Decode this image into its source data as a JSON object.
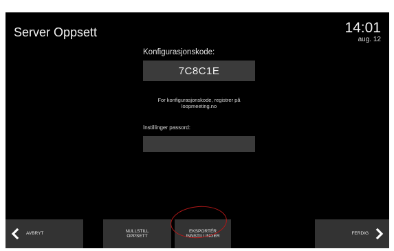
{
  "header": {
    "title": "Server Oppsett",
    "time": "14:01",
    "date": "aug. 12"
  },
  "config": {
    "label": "Konfigurasjonskode:",
    "code": "7C8C1E",
    "info_line1": "For konfigurasjonskode, registrer på",
    "info_line2": "loopmeeting.no"
  },
  "password": {
    "label": "Instillinger passord:",
    "value": ""
  },
  "buttons": {
    "back": "AVBRYT",
    "reset_line1": "NULLSTILL",
    "reset_line2": "OPPSETT",
    "export_line1": "EKSPORTÉR",
    "export_line2": "INNSTILLINGER",
    "done": "FERDIG"
  },
  "colors": {
    "background": "#000000",
    "panel": "#3b3b3b",
    "button": "#333333",
    "annotation": "#b01818"
  },
  "icons": {
    "back": "chevron-left-icon",
    "done": "chevron-right-icon"
  }
}
